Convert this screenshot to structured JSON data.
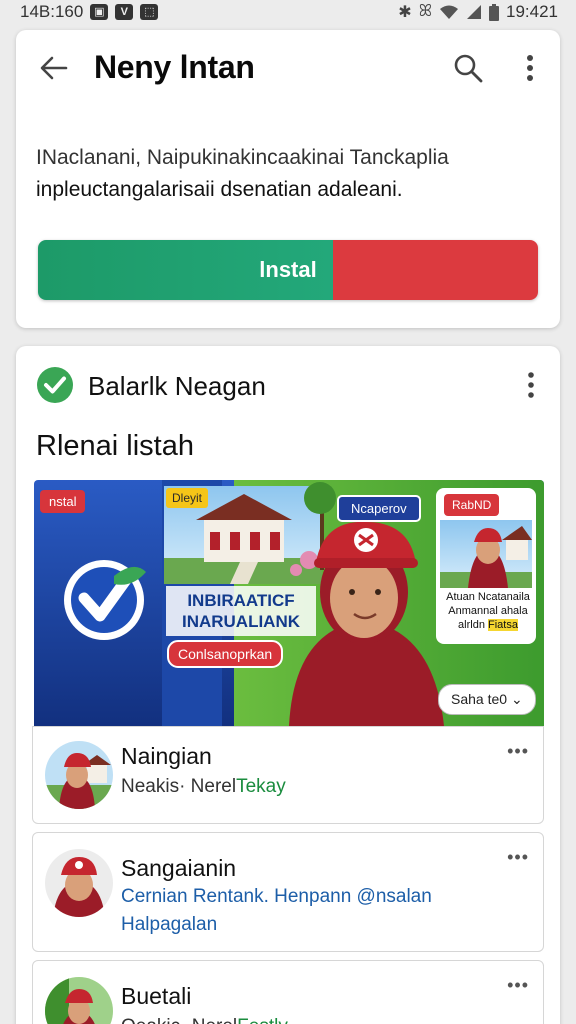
{
  "status_bar": {
    "time_left": "14B:160",
    "time_right": "19:421"
  },
  "app_bar": {
    "title": "Neny lntan"
  },
  "description": {
    "line1": "INaclanani, Naipukinakincaakinai Tanckaplia",
    "line2": "inpleuctangalarisaii dsenatian adaleani."
  },
  "install_button": {
    "label": "lnstal",
    "color_left": "#1d9a68",
    "color_right": "#dc3a3f"
  },
  "section": {
    "title": "Balarlk Neagan",
    "list_title": "Rlenai listah"
  },
  "banner": {
    "tag_top_left": "nstal",
    "tag_yellow": "Dleyit",
    "tag_blue": "Ncaperov",
    "tag_right": "RabND",
    "title_line1": "INBIRAATICF",
    "title_line2": "INARUALIANK",
    "chip": "Conlsanoprkan",
    "side_text_1": "Atuan Ncatanaila",
    "side_text_2": "Anmannal ahala",
    "side_text_3": "alrldn",
    "side_text_highlight": "Fiatsa",
    "select_label": "Saha te0"
  },
  "items": [
    {
      "name": "Naingian",
      "sub_prefix": "Neakis· Nerel",
      "sub_highlight": "Tekay"
    },
    {
      "name": "Sangaianin",
      "sub_line1": "Cernian Rentank. Henpann @nsalan",
      "sub_line2": "Halpagalan"
    },
    {
      "name": "Buetali",
      "sub_prefix": "Oeakic· Nerel",
      "sub_highlight": "Festly"
    }
  ],
  "colors": {
    "accent_green": "#1a8c3e",
    "accent_red": "#d7353b",
    "check_green": "#3aa655"
  }
}
